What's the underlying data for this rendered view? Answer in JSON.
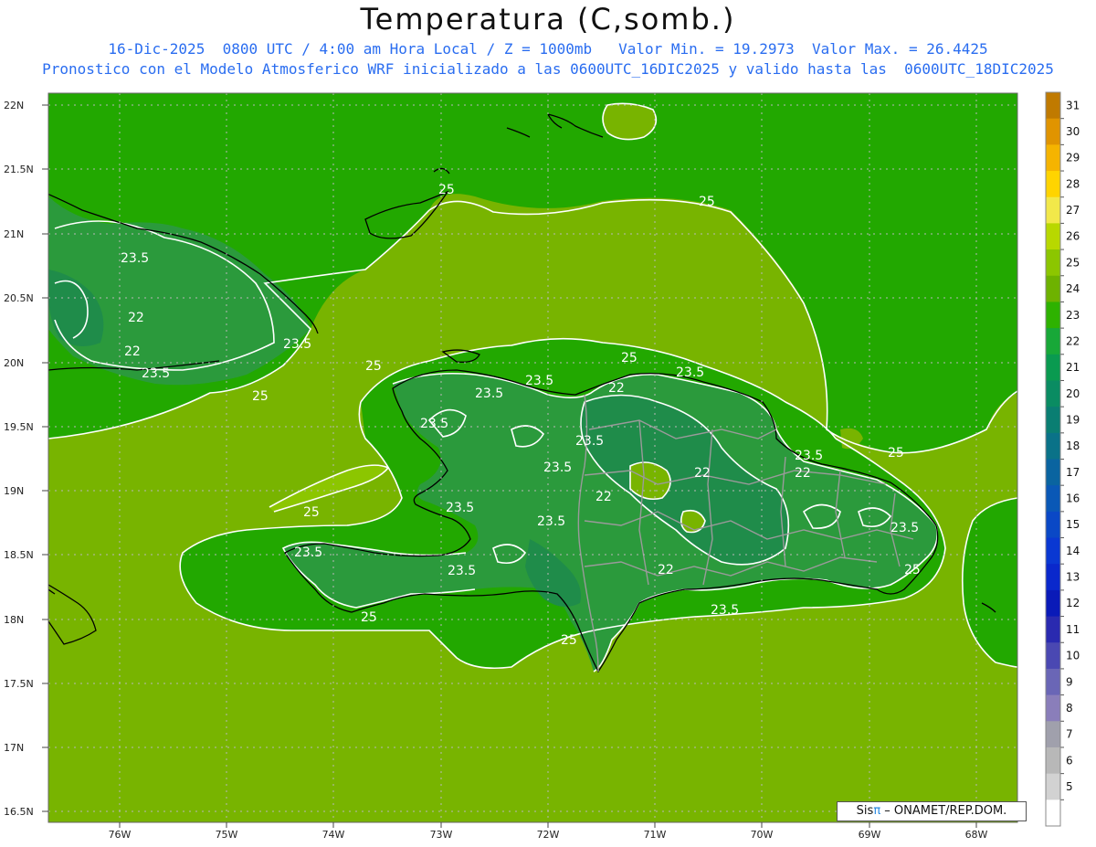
{
  "title": "Temperatura (C,somb.)",
  "subtitle_line1": "16-Dic-2025  0800 UTC / 4:00 am Hora Local / Z = 1000mb   Valor Min. = 19.2973  Valor Max. = 26.4425",
  "subtitle_line2": "Pronostico con el Modelo Atmosferico WRF inicializado a las 0600UTC_16DIC2025 y valido hasta las  0600UTC_18DIC2025",
  "credit": {
    "prefix": "Sis",
    "pi": "π",
    "suffix": "– ONAMET/REP.DOM."
  },
  "lat_labels": [
    "22N",
    "21.5N",
    "21N",
    "20.5N",
    "20N",
    "19.5N",
    "19N",
    "18.5N",
    "18N",
    "17.5N",
    "17N",
    "16.5N"
  ],
  "lon_labels": [
    "76W",
    "75W",
    "74W",
    "73W",
    "72W",
    "71W",
    "70W",
    "69W",
    "68W"
  ],
  "colorbar": {
    "ticks": [
      "31",
      "30",
      "29",
      "28",
      "27",
      "26",
      "25",
      "24",
      "23",
      "22",
      "21",
      "20",
      "19",
      "18",
      "17",
      "16",
      "15",
      "14",
      "13",
      "12",
      "11",
      "10",
      "9",
      "8",
      "7",
      "6",
      "5"
    ],
    "colors": [
      "#c07a00",
      "#e09400",
      "#f5b400",
      "#ffd400",
      "#f2e84a",
      "#b8d800",
      "#8cc600",
      "#6eb200",
      "#2eb200",
      "#18a838",
      "#0a9a50",
      "#0a8c62",
      "#0a7e72",
      "#0a7288",
      "#0a64a0",
      "#0a58b6",
      "#0a48c6",
      "#0a38d2",
      "#0a28cc",
      "#0a1ab8",
      "#2a2ab0",
      "#4a48b2",
      "#6a66b6",
      "#8a7eba",
      "#a0a0ac",
      "#b8b8b8",
      "#d2d2d2",
      "#ffffff"
    ]
  },
  "contour_labels": [
    "25",
    "25",
    "25",
    "25",
    "25",
    "25",
    "25",
    "25",
    "25",
    "25",
    "23.5",
    "23.5",
    "23.5",
    "23.5",
    "23.5",
    "23.5",
    "23.5",
    "23.5",
    "23.5",
    "23.5",
    "23.5",
    "23.5",
    "23.5",
    "23.5",
    "23.5",
    "23.5",
    "22",
    "22",
    "22",
    "22",
    "22",
    "22",
    "22"
  ],
  "map_colors": {
    "warm_sea": "#78b400",
    "cool_sea": "#22a800",
    "land_cool": "#1f8c4a",
    "land_mid": "#2b9a3c",
    "contour": "#ffffff",
    "border": "#9a9a9a",
    "coast": "#000000"
  }
}
